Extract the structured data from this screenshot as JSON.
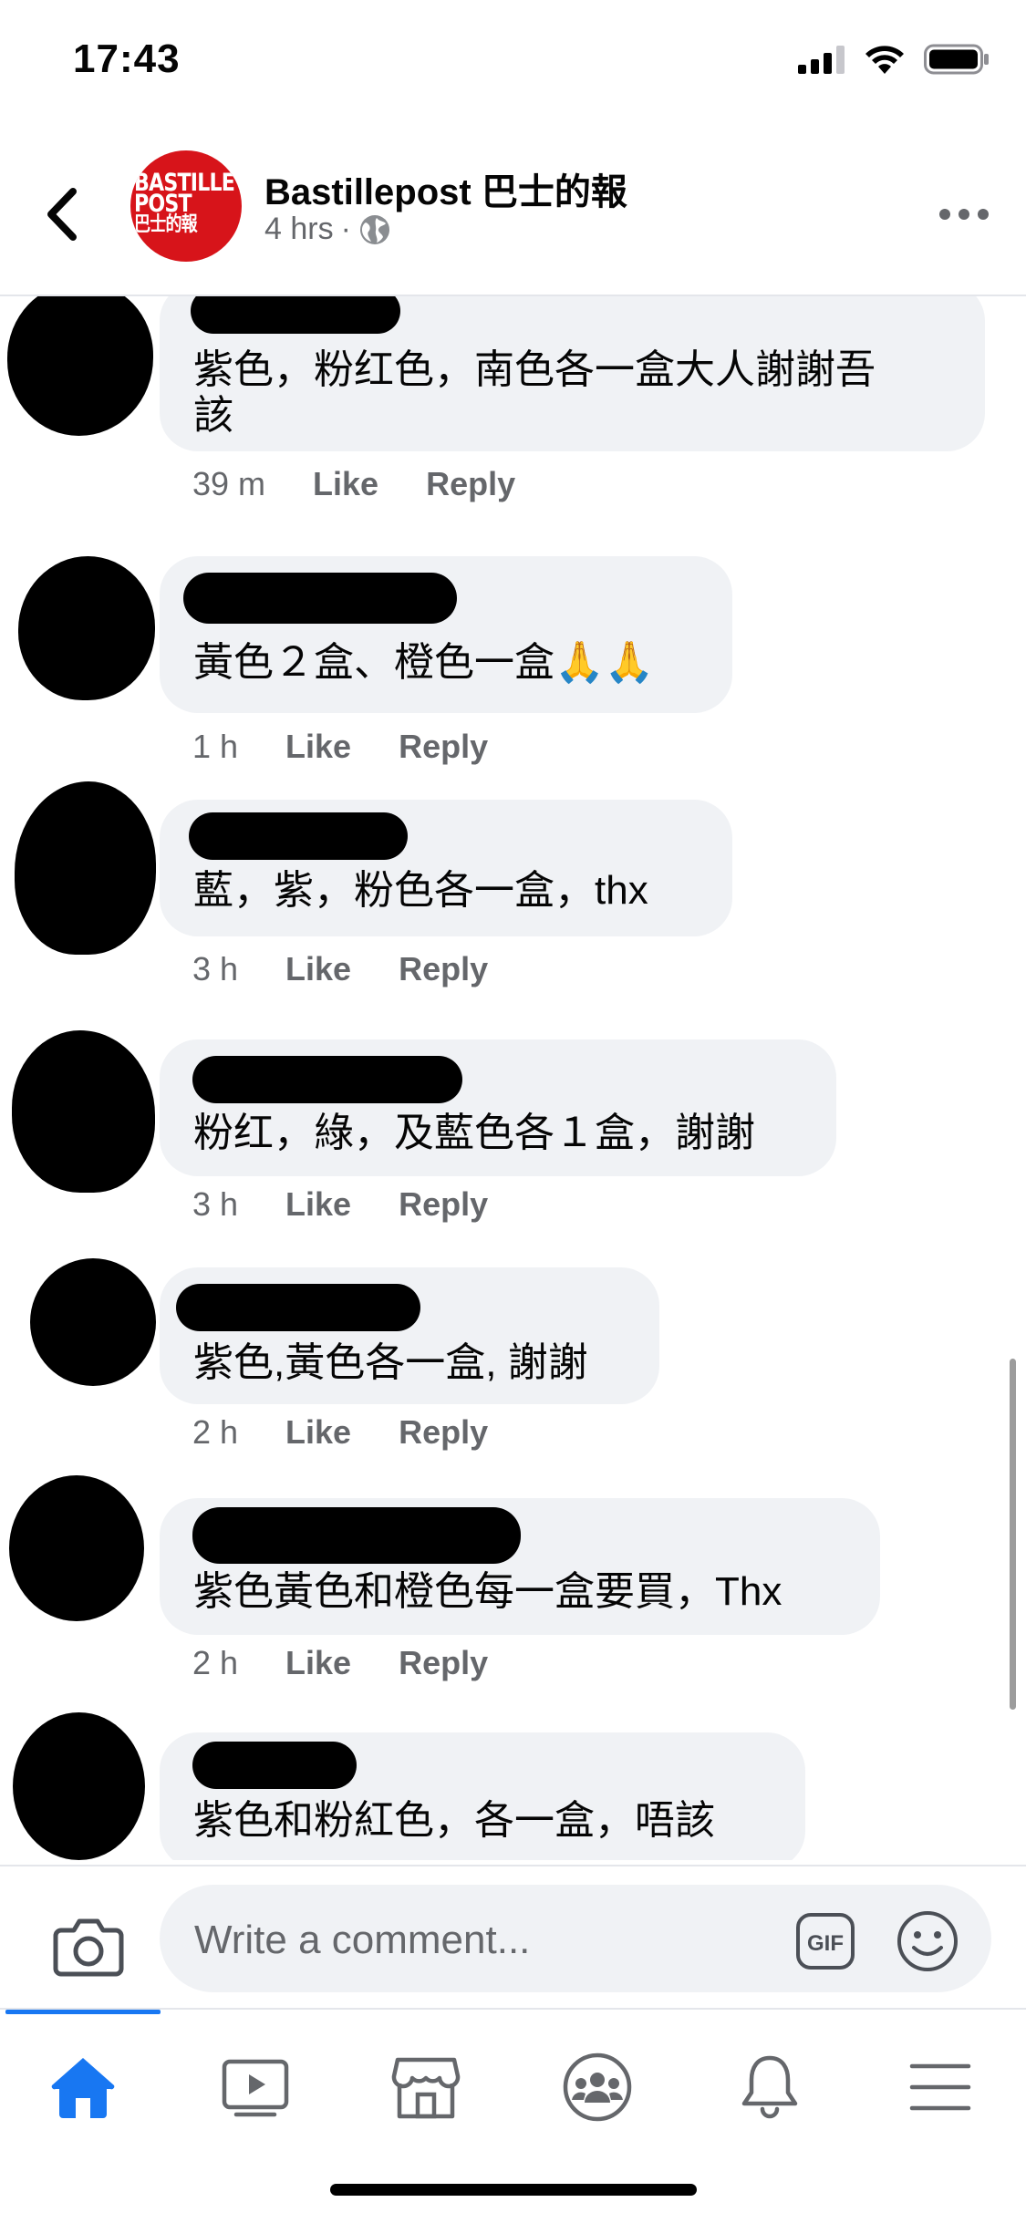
{
  "status_bar": {
    "time": "17:43"
  },
  "header": {
    "page_name": "Bastillepost 巴士的報",
    "post_time": "4 hrs",
    "separator": "·",
    "logo": {
      "line1": "BASTILLE",
      "line2": "POST",
      "line3": "巴士的報"
    }
  },
  "comments": [
    {
      "text_lines": [
        "紫色，粉红色，南色各一盒大人謝謝吾",
        "該"
      ],
      "time": "39 m",
      "like": "Like",
      "reply": "Reply"
    },
    {
      "text_lines": [
        "黃色２盒、橙色一盒🙏🙏"
      ],
      "time": "1 h",
      "like": "Like",
      "reply": "Reply"
    },
    {
      "text_lines": [
        "藍，紫，粉色各一盒，thx"
      ],
      "time": "3 h",
      "like": "Like",
      "reply": "Reply"
    },
    {
      "text_lines": [
        "粉红，綠，及藍色各１盒，謝謝"
      ],
      "time": "3 h",
      "like": "Like",
      "reply": "Reply"
    },
    {
      "text_lines": [
        "紫色,黃色各一盒, 謝謝"
      ],
      "time": "2 h",
      "like": "Like",
      "reply": "Reply"
    },
    {
      "text_lines": [
        "紫色黃色和橙色每一盒要買，Thx"
      ],
      "time": "2 h",
      "like": "Like",
      "reply": "Reply"
    },
    {
      "text_lines": [
        "紫色和粉紅色，各一盒，唔該"
      ],
      "time": "",
      "like": "",
      "reply": ""
    }
  ],
  "composer": {
    "placeholder": "Write a comment...",
    "gif_label": "GIF"
  },
  "tabbar": {
    "tabs": [
      {
        "name": "Home",
        "icon": "home-icon",
        "active": true
      },
      {
        "name": "Watch",
        "icon": "video-icon"
      },
      {
        "name": "Marketplace",
        "icon": "marketplace-icon"
      },
      {
        "name": "Groups",
        "icon": "groups-icon"
      },
      {
        "name": "Notifications",
        "icon": "bell-icon"
      },
      {
        "name": "Menu",
        "icon": "menu-icon"
      }
    ]
  },
  "colors": {
    "accent": "#1877f2",
    "bubble": "#f0f2f5",
    "secondary_text": "#65676b",
    "logo_red": "#d7141a"
  }
}
